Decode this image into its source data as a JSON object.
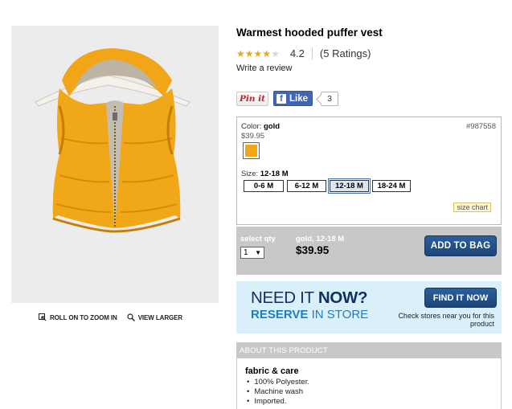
{
  "product": {
    "title": "Warmest hooded puffer vest",
    "rating": {
      "value": "4.2",
      "count_text": "(5 Ratings)",
      "stars_filled": 4,
      "stars_total": 5
    },
    "write_review": "Write a review"
  },
  "image_tools": {
    "zoom_label": "ROLL ON TO ZOOM IN",
    "larger_label": "VIEW LARGER"
  },
  "social": {
    "pin_label": "Pin it",
    "like_label": "Like",
    "like_count": "3"
  },
  "options": {
    "color_label": "Color:",
    "color_value": "gold",
    "sku": "#987558",
    "base_price": "$39.95",
    "swatch_color": "#f0a818",
    "size_label": "Size:",
    "size_value": "12-18 M",
    "sizes": [
      "0-6 M",
      "6-12 M",
      "12-18 M",
      "18-24 M"
    ],
    "selected_size": "12-18 M",
    "size_chart": "size chart"
  },
  "bag": {
    "qty_label": "select qty",
    "qty_value": "1",
    "selection_name": "gold, 12-18 M",
    "selection_price": "$39.95",
    "add_label": "ADD TO BAG"
  },
  "reserve": {
    "need_it": "NEED IT",
    "now": "NOW?",
    "reserve": "RESERVE",
    "in_store": "IN STORE",
    "find_label": "FIND IT NOW",
    "check_stores": "Check stores near you for this product"
  },
  "about": {
    "header": "ABOUT THIS PRODUCT",
    "section_title": "fabric & care",
    "items": [
      "100% Polyester.",
      "Machine wash",
      "Imported."
    ]
  },
  "colors": {
    "button_blue": "#1d4579",
    "reserve_bg": "#d9effa",
    "star": "#e8a825",
    "product_gold": "#f0a818"
  }
}
